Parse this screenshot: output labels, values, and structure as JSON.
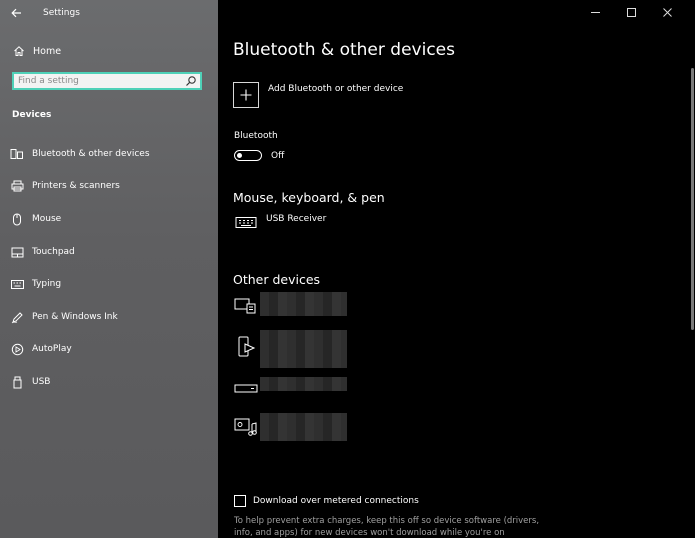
{
  "app": {
    "title": "Settings"
  },
  "sidebar": {
    "home_label": "Home",
    "search_placeholder": "Find a setting",
    "section_header": "Devices",
    "items": [
      {
        "label": "Bluetooth & other devices",
        "icon": "bluetooth-devices-icon"
      },
      {
        "label": "Printers & scanners",
        "icon": "printer-icon"
      },
      {
        "label": "Mouse",
        "icon": "mouse-icon"
      },
      {
        "label": "Touchpad",
        "icon": "touchpad-icon"
      },
      {
        "label": "Typing",
        "icon": "keyboard-icon"
      },
      {
        "label": "Pen & Windows Ink",
        "icon": "pen-icon"
      },
      {
        "label": "AutoPlay",
        "icon": "autoplay-icon"
      },
      {
        "label": "USB",
        "icon": "usb-icon"
      }
    ]
  },
  "main": {
    "title": "Bluetooth & other devices",
    "add_device_label": "Add Bluetooth or other device",
    "bluetooth": {
      "label": "Bluetooth",
      "state": "Off"
    },
    "mouse_section": {
      "title": "Mouse, keyboard, & pen",
      "devices": [
        {
          "name": "USB Receiver",
          "icon": "keyboard-icon"
        }
      ]
    },
    "other_section": {
      "title": "Other devices",
      "devices": [
        {
          "icon": "display-wireless-icon"
        },
        {
          "icon": "phone-media-icon"
        },
        {
          "icon": "drive-icon"
        },
        {
          "icon": "media-device-icon"
        }
      ]
    },
    "metered": {
      "label": "Download over metered connections",
      "help": "To help prevent extra charges, keep this off so device software (drivers, info, and apps) for new devices won't download while you're on"
    }
  },
  "colors": {
    "accent": "#4fd1b8",
    "sidebar_bg": "#5f5f61",
    "main_bg": "#000000"
  }
}
